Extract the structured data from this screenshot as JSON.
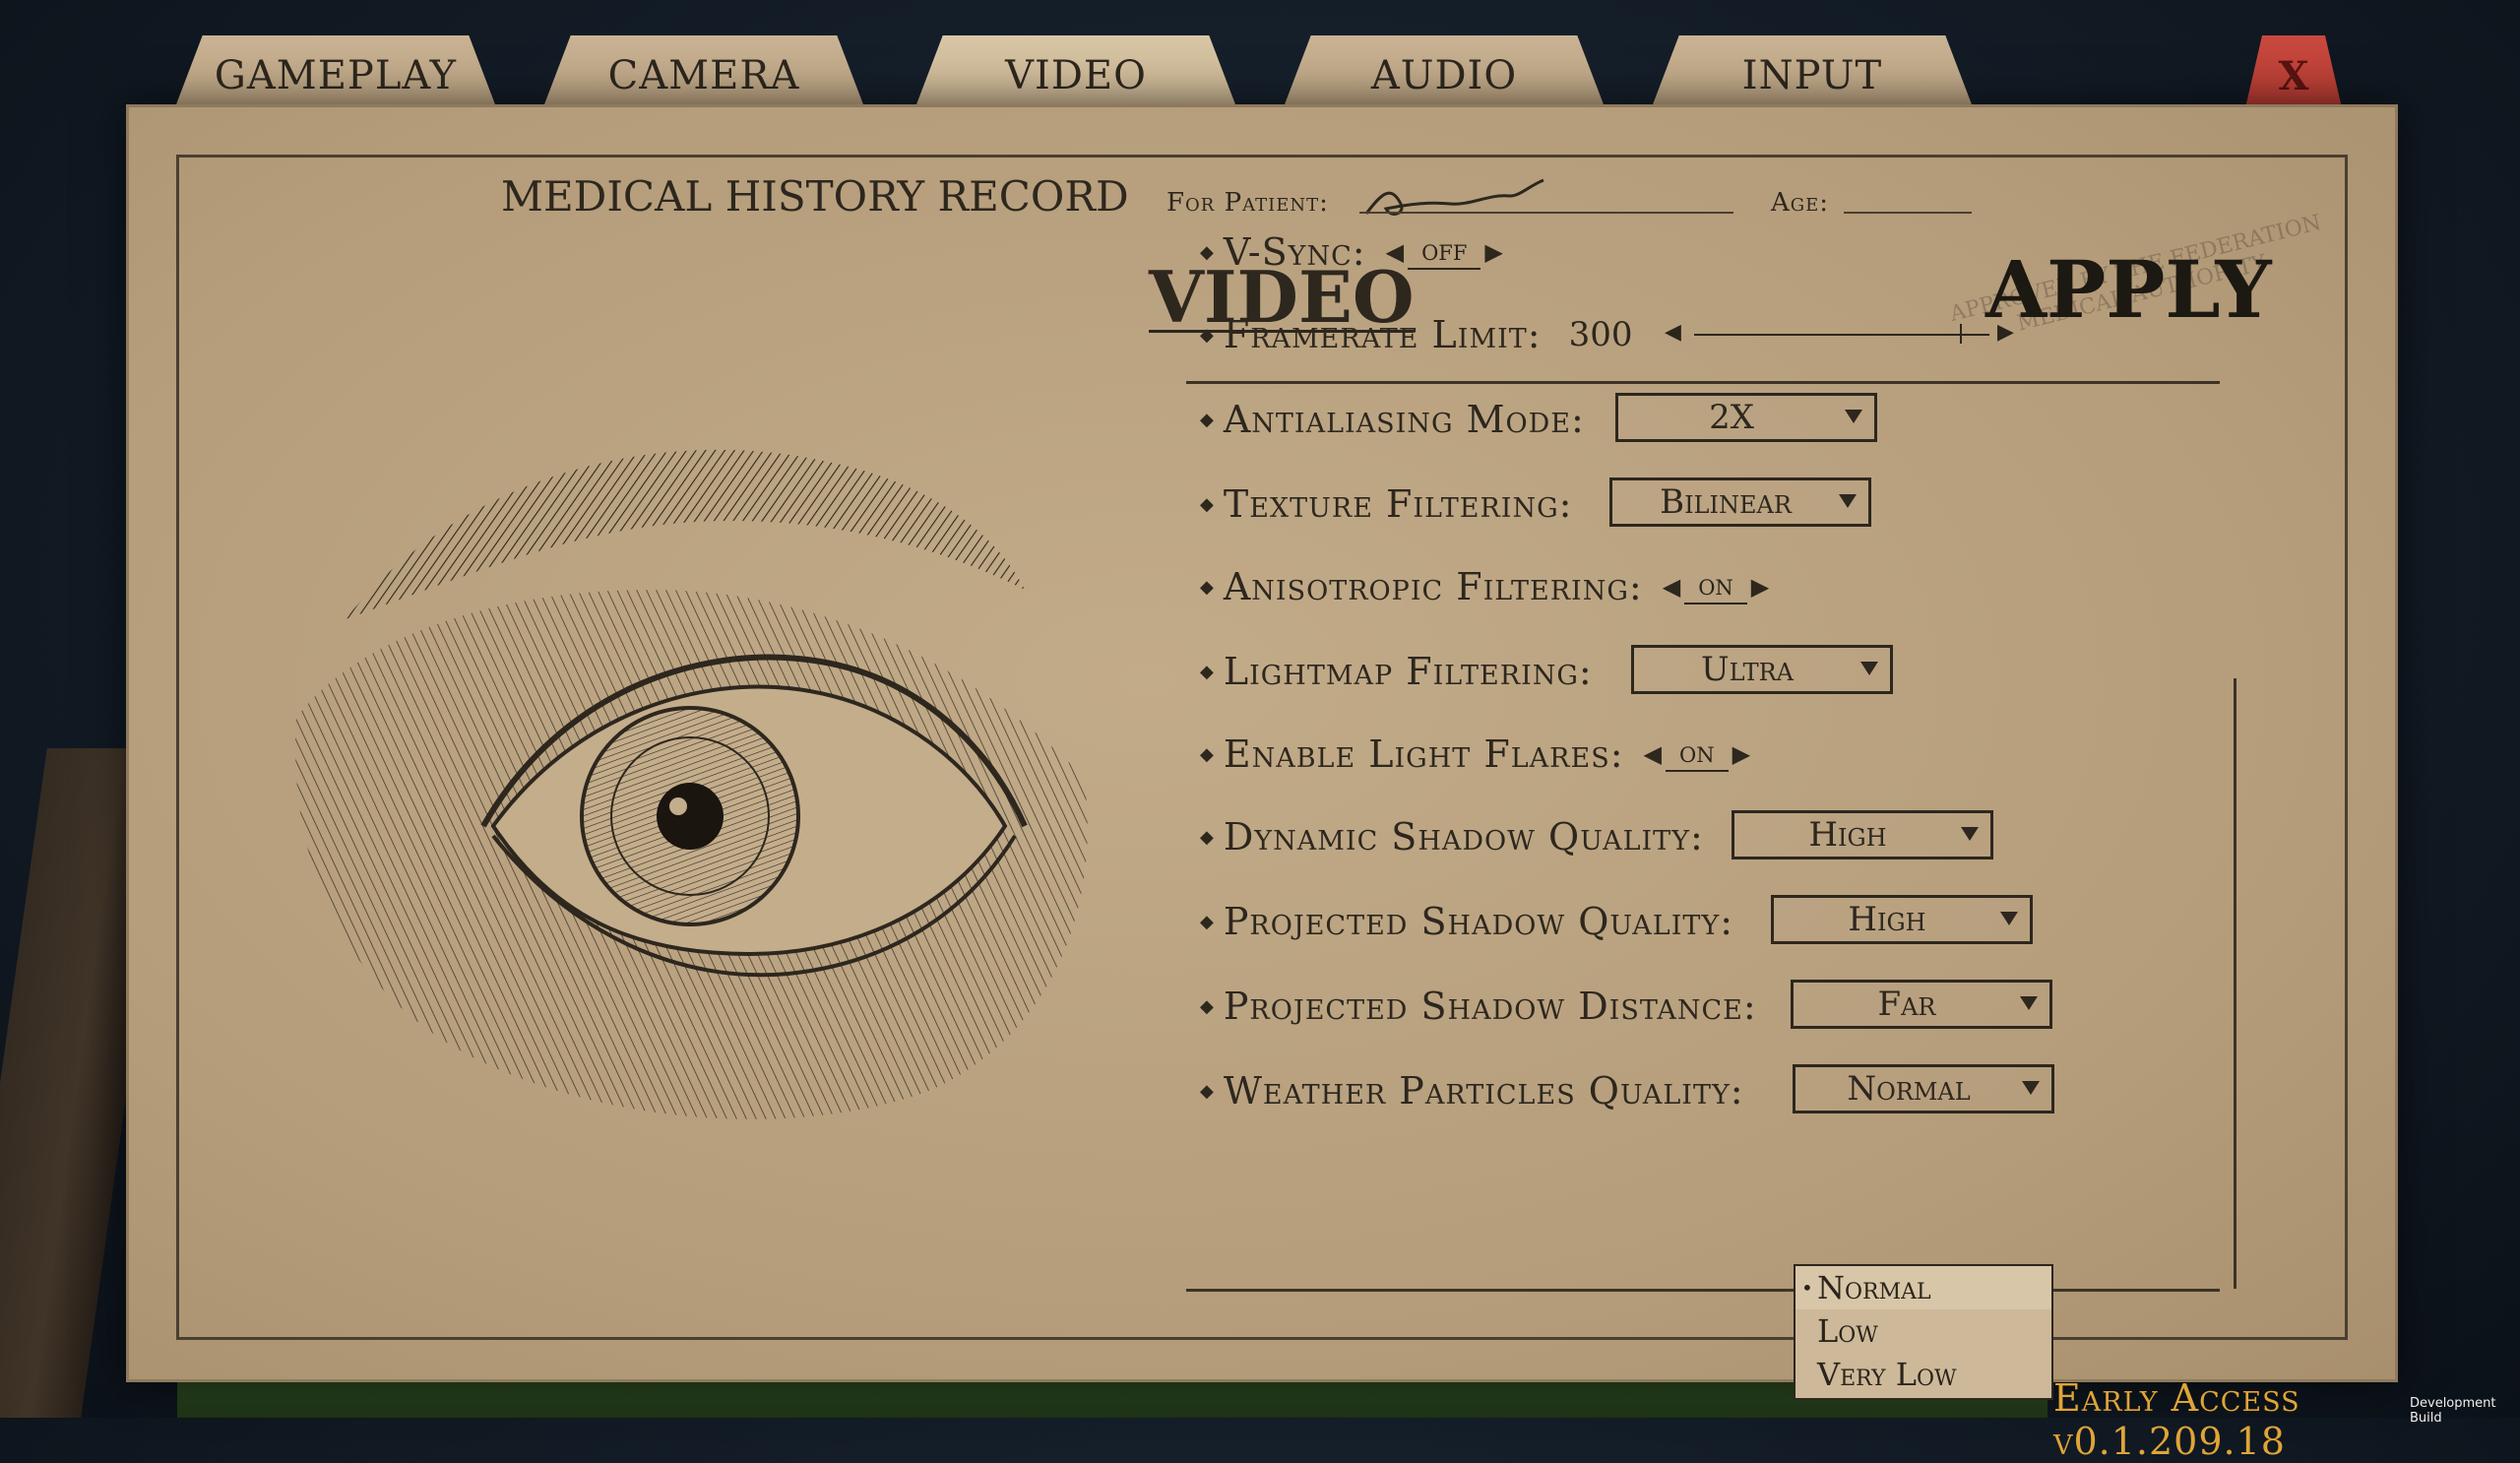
{
  "tabs": [
    {
      "label": "GAMEPLAY"
    },
    {
      "label": "CAMERA"
    },
    {
      "label": "VIDEO"
    },
    {
      "label": "AUDIO"
    },
    {
      "label": "INPUT"
    }
  ],
  "active_tab": "VIDEO",
  "close_label": "X",
  "header": {
    "title": "MEDICAL HISTORY RECORD",
    "patient_label": "For Patient:",
    "age_label": "Age:"
  },
  "section_title": "VIDEO",
  "apply_label": "APPLY",
  "stamp_text": "APPROVED BY THE FEDERATION MEDICAL AUTHORITY",
  "settings": [
    {
      "label": "V-Sync:",
      "control": "stepper",
      "value": "off"
    },
    {
      "label": "Framerate Limit:",
      "control": "slider",
      "value": "300",
      "fraction": 0.9
    },
    {
      "label": "Antialiasing Mode:",
      "control": "dropdown",
      "value": "2X"
    },
    {
      "label": "Texture Filtering:",
      "control": "dropdown",
      "value": "Bilinear"
    },
    {
      "label": "Anisotropic Filtering:",
      "control": "stepper",
      "value": "on"
    },
    {
      "label": "Lightmap Filtering:",
      "control": "dropdown",
      "value": "Ultra"
    },
    {
      "label": "Enable Light Flares:",
      "control": "stepper",
      "value": "on"
    },
    {
      "label": "Dynamic Shadow Quality:",
      "control": "dropdown",
      "value": "High"
    },
    {
      "label": "Projected Shadow Quality:",
      "control": "dropdown",
      "value": "High"
    },
    {
      "label": "Projected Shadow Distance:",
      "control": "dropdown",
      "value": "Far"
    },
    {
      "label": "Weather Particles Quality:",
      "control": "dropdown",
      "value": "Normal"
    }
  ],
  "weather_dropdown_options": [
    {
      "label": "Normal",
      "selected": true
    },
    {
      "label": "Low",
      "selected": false
    },
    {
      "label": "Very Low",
      "selected": false
    }
  ],
  "version": "Early Access  v0.1.209.18",
  "dev_build": "Development Build",
  "colors": {
    "paper": "#b59d7b",
    "ink": "#2d271e",
    "close_tab": "#b23a31",
    "version_text": "#e0a437"
  }
}
